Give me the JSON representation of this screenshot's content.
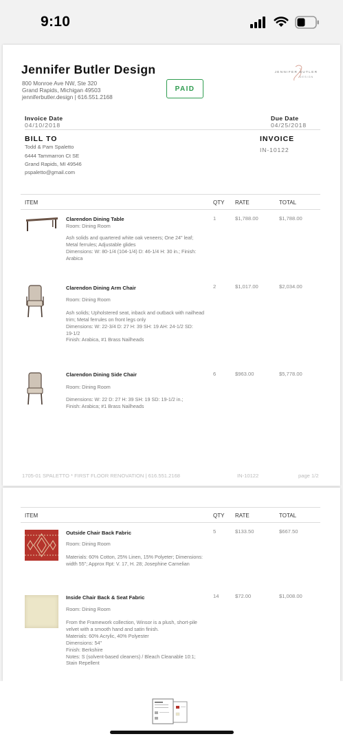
{
  "status_bar": {
    "time": "9:10"
  },
  "page1": {
    "company": {
      "name": "Jennifer Butler Design",
      "address1": "800 Monroe Ave NW, Ste 320",
      "address2": "Grand Rapids, Michigan 49503",
      "web_phone": "jenniferbutler.design | 616.551.2168",
      "logo_text_top": "JENNIFER BUTLER",
      "logo_text_bottom": "DESIGN"
    },
    "status_stamp": "PAID",
    "invoice_date_label": "Invoice Date",
    "invoice_date": "04/10/2018",
    "due_date_label": "Due Date",
    "due_date": "04/25/2018",
    "bill_to_label": "BILL TO",
    "bill_to": [
      "Todd & Pam Spaletto",
      "6444 Tammarron Ct SE",
      "Grand Rapids, MI 49546",
      "pspaletto@gmail.com"
    ],
    "invoice_label": "INVOICE",
    "invoice_number": "IN-10122",
    "columns": {
      "item": "ITEM",
      "qty": "QTY",
      "rate": "RATE",
      "total": "TOTAL"
    },
    "items": [
      {
        "name": "Clarendon Dining Table",
        "room": "Room: Dining Room",
        "desc": [
          "Ash solids and quartered white oak veneers; One 24\" leaf;",
          "Metal ferrules; Adjustable glides",
          "Dimensions: W: 80-1/4 (104-1/4) D: 46-1/4 H: 30 in.; Finish:",
          "Arabica"
        ],
        "qty": "1",
        "rate": "$1,788.00",
        "total": "$1,788.00",
        "icon": "table-icon"
      },
      {
        "name": "Clarendon Dining Arm Chair",
        "room": "Room: Dining Room",
        "desc": [
          "Ash solids; Upholstered seat, inback and outback with nailhead",
          "trim; Metal ferrules on front legs only",
          "Dimensions: W: 22-3/4 D: 27 H: 39 SH: 19 AH: 24-1/2 SD:",
          "19-1/2",
          "Finish: Arabica, #1 Brass Nailheads"
        ],
        "qty": "2",
        "rate": "$1,017.00",
        "total": "$2,034.00",
        "icon": "arm-chair-icon"
      },
      {
        "name": "Clarendon Dining Side Chair",
        "room": "Room: Dining Room",
        "desc": [
          "Dimensions: W: 22 D: 27 H: 39 SH: 19 SD: 19-1/2 in.;",
          "Finish: Arabica; #1 Brass Nailheads"
        ],
        "qty": "6",
        "rate": "$963.00",
        "total": "$5,778.00",
        "icon": "side-chair-icon"
      }
    ],
    "footer": {
      "project": "1705-01 SPALETTO * FIRST FLOOR RENOVATION | 616.551.2168",
      "invoice": "IN-10122",
      "page": "page 1/2"
    }
  },
  "page2": {
    "columns": {
      "item": "ITEM",
      "qty": "QTY",
      "rate": "RATE",
      "total": "TOTAL"
    },
    "items": [
      {
        "name": "Outside Chair Back Fabric",
        "room": "Room: Dining Room",
        "desc": [
          "Materials: 60% Cotton, 25% Linen, 15% Polyeter; Dimensions:",
          "width 55\"; Approx Rpt: V. 17, H. 28; Josephine Carnelian"
        ],
        "qty": "5",
        "rate": "$133.50",
        "total": "$667.50",
        "icon": "red-fabric-swatch"
      },
      {
        "name": "Inside Chair Back & Seat Fabric",
        "room": "Room: Dining Room",
        "desc": [
          "From the Framework collection, Winsor is a plush, short-pile",
          "velvet with a smooth hand and satin finish.",
          "Materials: 60% Acrylic, 40% Polyester",
          "Dimensions: 54\"",
          "Finish: Berkshire",
          "Notes: S (solvent-based cleaners) / Bleach Cleanable 10:1;",
          "Stain Repellent"
        ],
        "qty": "14",
        "rate": "$72.00",
        "total": "$1,008.00",
        "icon": "cream-fabric-swatch"
      }
    ]
  },
  "colors": {
    "paid": "#2e9c4f",
    "fabric_red": "#b5342c",
    "fabric_cream": "#ece6c8"
  }
}
